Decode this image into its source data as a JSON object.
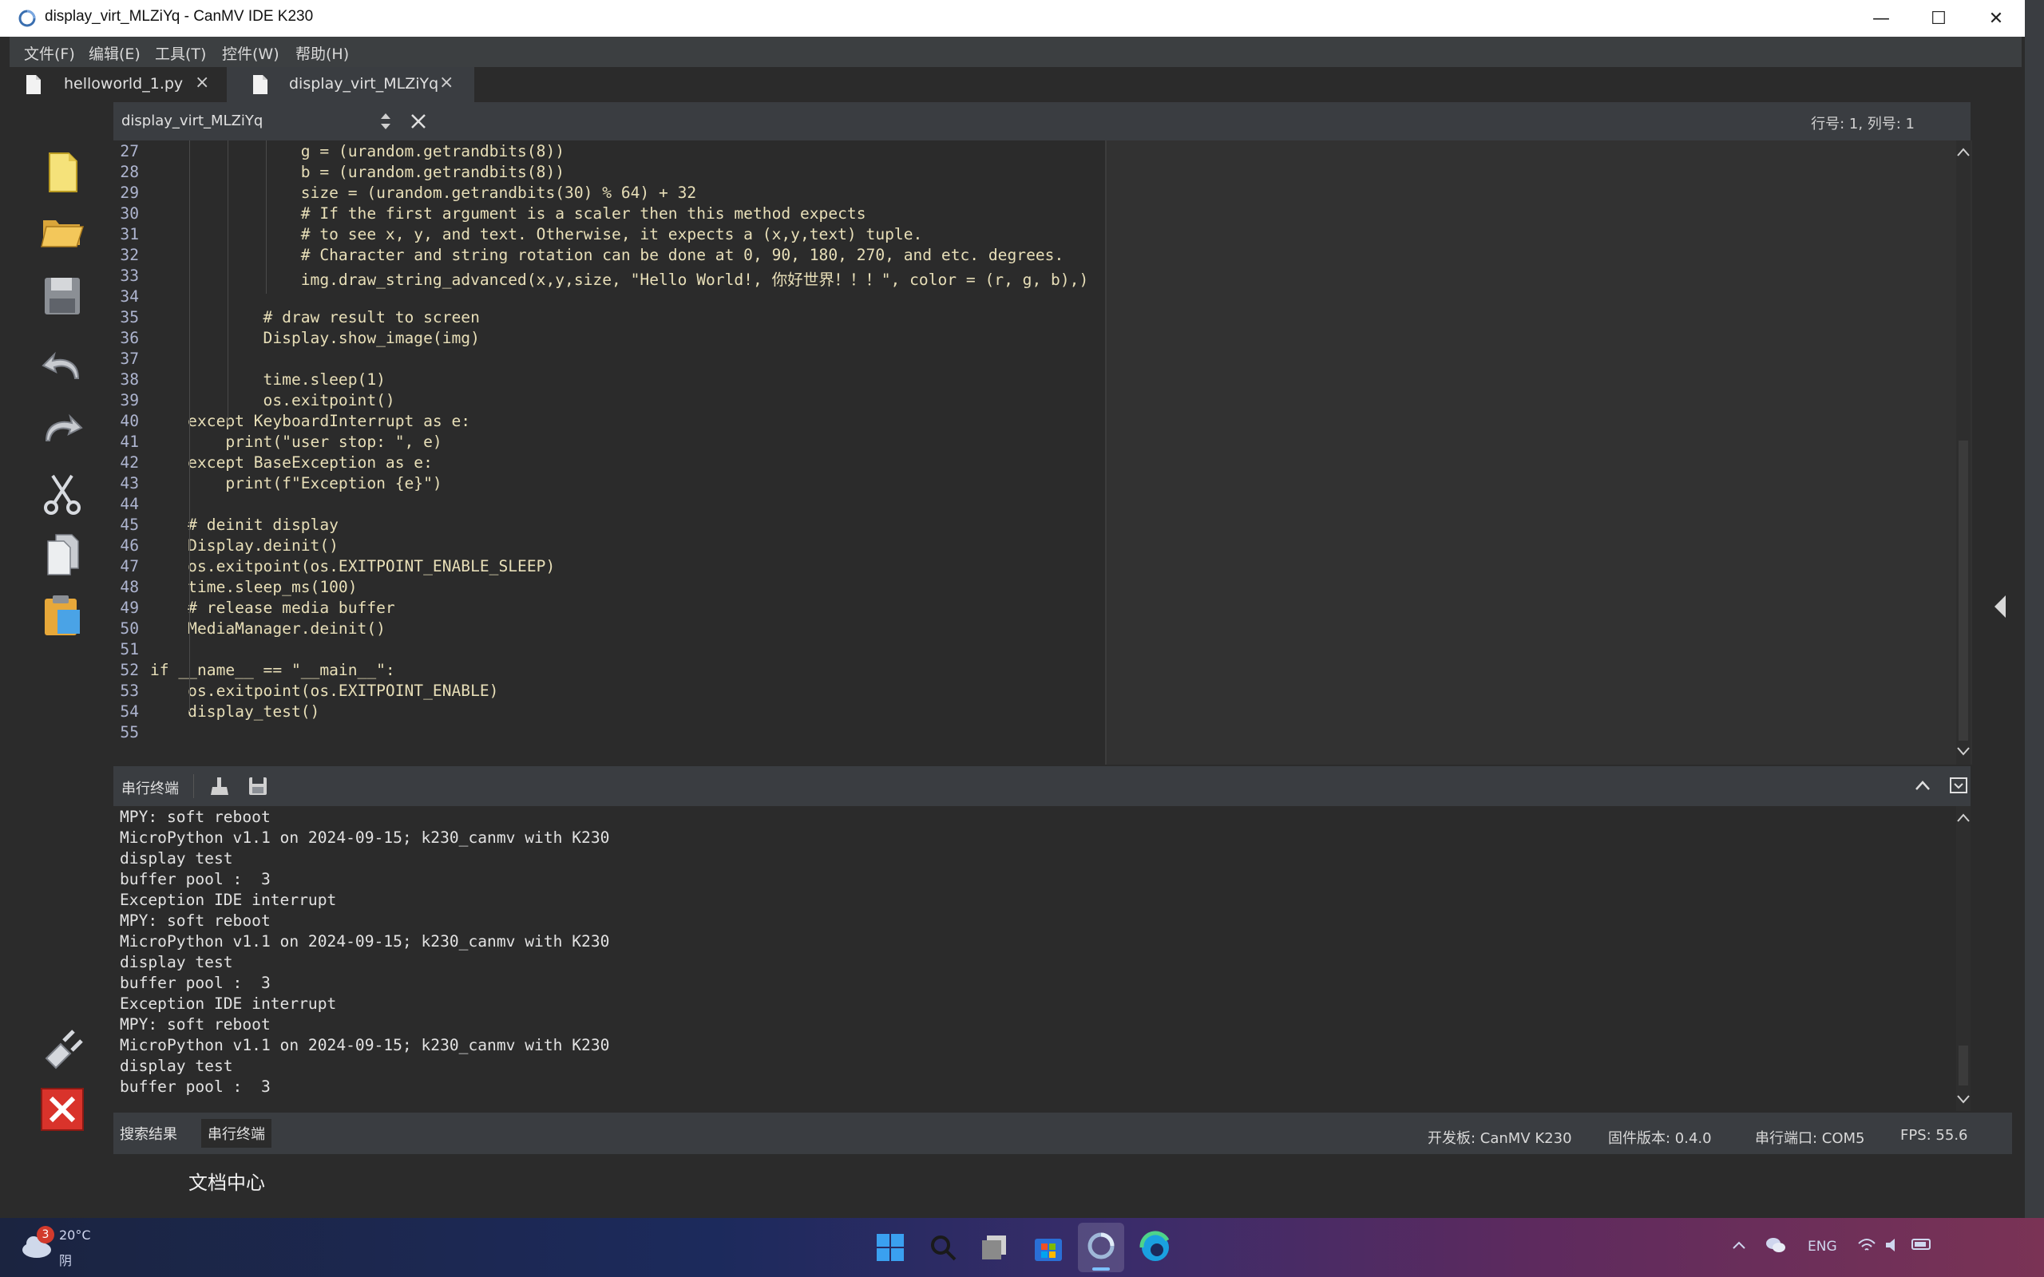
{
  "window": {
    "title": "display_virt_MLZiYq - CanMV IDE K230",
    "minimize": "—",
    "maximize": "☐",
    "close": "✕"
  },
  "menu": [
    "文件(F)",
    "编辑(E)",
    "工具(T)",
    "控件(W)",
    "帮助(H)"
  ],
  "tabs": [
    {
      "label": "helloworld_1.py",
      "close": "×"
    },
    {
      "label": "display_virt_MLZiYq",
      "close": "×"
    }
  ],
  "editor": {
    "file_selector": "display_virt_MLZiYq",
    "cursor_position": "行号: 1, 列号: 1",
    "lines": [
      {
        "n": "27",
        "t": "                g = (urandom.getrandbits(8))"
      },
      {
        "n": "28",
        "t": "                b = (urandom.getrandbits(8))"
      },
      {
        "n": "29",
        "t": "                size = (urandom.getrandbits(30) % 64) + 32"
      },
      {
        "n": "30",
        "t": "                # If the first argument is a scaler then this method expects"
      },
      {
        "n": "31",
        "t": "                # to see x, y, and text. Otherwise, it expects a (x,y,text) tuple."
      },
      {
        "n": "32",
        "t": "                # Character and string rotation can be done at 0, 90, 180, 270, and etc. degrees."
      },
      {
        "n": "33",
        "t": "                img.draw_string_advanced(x,y,size, \"Hello World!, 你好世界！！！\", color = (r, g, b),)"
      },
      {
        "n": "34",
        "t": ""
      },
      {
        "n": "35",
        "t": "            # draw result to screen"
      },
      {
        "n": "36",
        "t": "            Display.show_image(img)"
      },
      {
        "n": "37",
        "t": ""
      },
      {
        "n": "38",
        "t": "            time.sleep(1)"
      },
      {
        "n": "39",
        "t": "            os.exitpoint()"
      },
      {
        "n": "40",
        "t": "    except KeyboardInterrupt as e:"
      },
      {
        "n": "41",
        "t": "        print(\"user stop: \", e)"
      },
      {
        "n": "42",
        "t": "    except BaseException as e:"
      },
      {
        "n": "43",
        "t": "        print(f\"Exception {e}\")"
      },
      {
        "n": "44",
        "t": ""
      },
      {
        "n": "45",
        "t": "    # deinit display"
      },
      {
        "n": "46",
        "t": "    Display.deinit()"
      },
      {
        "n": "47",
        "t": "    os.exitpoint(os.EXITPOINT_ENABLE_SLEEP)"
      },
      {
        "n": "48",
        "t": "    time.sleep_ms(100)"
      },
      {
        "n": "49",
        "t": "    # release media buffer"
      },
      {
        "n": "50",
        "t": "    MediaManager.deinit()"
      },
      {
        "n": "51",
        "t": ""
      },
      {
        "n": "52",
        "t": "if __name__ == \"__main__\":"
      },
      {
        "n": "53",
        "t": "    os.exitpoint(os.EXITPOINT_ENABLE)"
      },
      {
        "n": "54",
        "t": "    display_test()"
      },
      {
        "n": "55",
        "t": ""
      }
    ]
  },
  "terminal": {
    "title": "串行终端",
    "lines": [
      "MPY: soft reboot",
      "MicroPython v1.1 on 2024-09-15; k230_canmv with K230",
      "display test",
      "buffer pool :  3",
      "Exception IDE interrupt",
      "MPY: soft reboot",
      "MicroPython v1.1 on 2024-09-15; k230_canmv with K230",
      "display test",
      "buffer pool :  3",
      "Exception IDE interrupt",
      "MPY: soft reboot",
      "MicroPython v1.1 on 2024-09-15; k230_canmv with K230",
      "display test",
      "buffer pool :  3"
    ]
  },
  "bottom_tabs": [
    "搜索结果",
    "串行终端"
  ],
  "status": {
    "board": "开发板: CanMV K230",
    "firmware": "固件版本: 0.4.0",
    "port": "串行端口: COM5",
    "fps": "FPS:  55.6"
  },
  "doc_center": "文档中心",
  "taskbar": {
    "weather_badge": "3",
    "weather_temp": "20°C",
    "weather_desc": "阴",
    "lang": "ENG"
  },
  "colors": {
    "code_text": "#e8dfb8",
    "line_number": "#aeb5d0",
    "editor_bg": "#2b2b2b",
    "panel_bg": "#3a3d41"
  }
}
